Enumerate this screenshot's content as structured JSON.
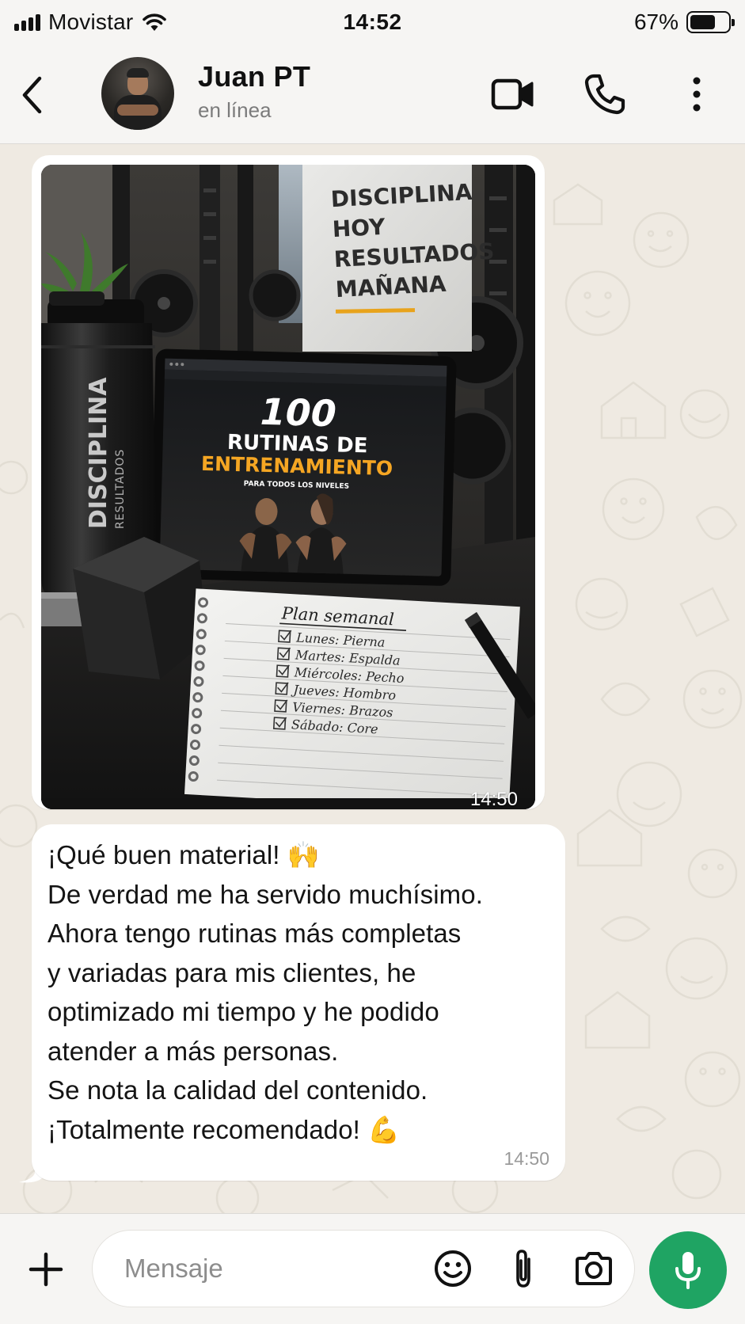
{
  "status_bar": {
    "carrier": "Movistar",
    "time": "14:52",
    "battery_percent": "67%",
    "battery_level": 0.67
  },
  "header": {
    "back_icon": "chevron-left-icon",
    "contact_name": "Juan PT",
    "contact_status": "en línea",
    "icons": [
      "video-camera-icon",
      "phone-icon",
      "more-vertical-icon"
    ]
  },
  "messages": [
    {
      "type": "image",
      "time": "14:50",
      "image": {
        "poster_text": [
          "DISCIPLINA",
          "HOY",
          "RESULTADOS",
          "MAÑANA"
        ],
        "bottle_text": "DISCIPLINA",
        "bottle_subtext": "RESULTADOS",
        "tablet_title_number": "100",
        "tablet_title_line1": "RUTINAS DE",
        "tablet_title_line2": "ENTRENAMIENTO",
        "tablet_subtitle": "PARA TODOS LOS NIVELES",
        "notepad_title": "Plan semanal",
        "notepad_items": [
          "Lunes: Pierna",
          "Martes: Espalda",
          "Miércoles: Pecho",
          "Jueves: Hombro",
          "Viernes: Brazos",
          "Sábado: Core"
        ]
      }
    },
    {
      "type": "text",
      "time": "14:50",
      "lines": [
        "¡Qué buen material! ",
        "De verdad me ha servido muchísimo.",
        "Ahora tengo rutinas más completas",
        "y variadas para mis clientes, he",
        "optimizado mi tiempo y he podido",
        "atender a más personas.",
        "Se nota la calidad del contenido.",
        "¡Totalmente recomendado! "
      ],
      "emoji_line1": "🙌",
      "emoji_line8": "💪"
    }
  ],
  "input_bar": {
    "placeholder": "Mensaje",
    "icons": [
      "plus-icon",
      "emoji-icon",
      "paperclip-icon",
      "camera-icon",
      "microphone-icon"
    ]
  },
  "colors": {
    "background": "#efeae2",
    "bubble": "#ffffff",
    "accent_green": "#1fa463",
    "orange": "#f5a623"
  }
}
